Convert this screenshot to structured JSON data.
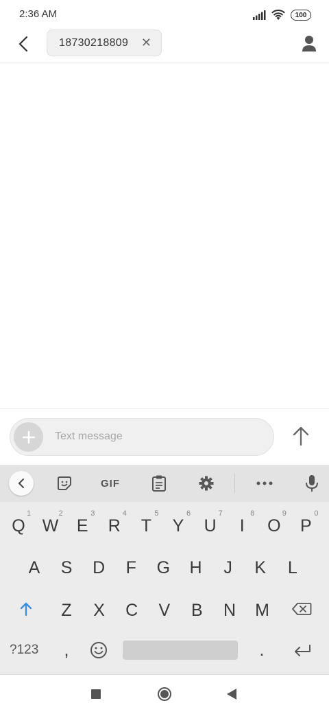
{
  "status_bar": {
    "time": "2:36 AM",
    "battery": "100"
  },
  "header": {
    "recipient": "18730218809"
  },
  "composer": {
    "placeholder": "Text message"
  },
  "keyboard": {
    "toolbar": {
      "gif_label": "GIF"
    },
    "row1": [
      {
        "key": "Q",
        "hint": "1"
      },
      {
        "key": "W",
        "hint": "2"
      },
      {
        "key": "E",
        "hint": "3"
      },
      {
        "key": "R",
        "hint": "4"
      },
      {
        "key": "T",
        "hint": "5"
      },
      {
        "key": "Y",
        "hint": "6"
      },
      {
        "key": "U",
        "hint": "7"
      },
      {
        "key": "I",
        "hint": "8"
      },
      {
        "key": "O",
        "hint": "9"
      },
      {
        "key": "P",
        "hint": "0"
      }
    ],
    "row2": [
      "A",
      "S",
      "D",
      "F",
      "G",
      "H",
      "J",
      "K",
      "L"
    ],
    "row3": [
      "Z",
      "X",
      "C",
      "V",
      "B",
      "N",
      "M"
    ],
    "row4": {
      "symbols": "?123",
      "comma": ",",
      "period": "."
    }
  }
}
